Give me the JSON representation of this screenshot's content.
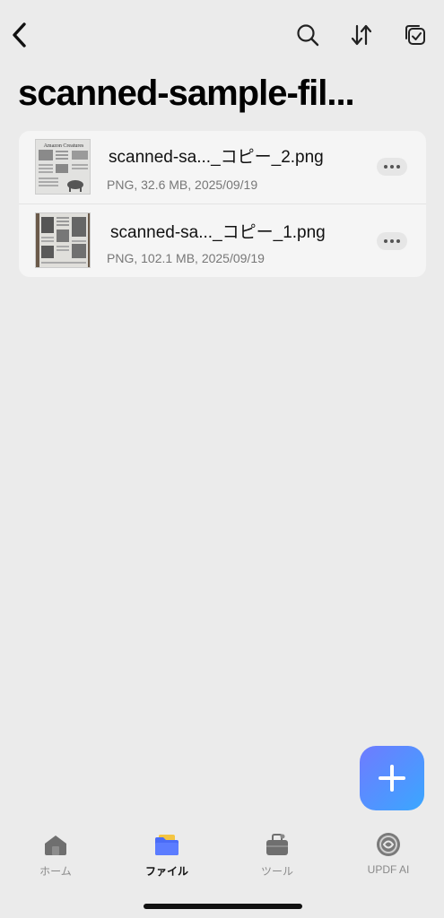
{
  "header": {
    "back_icon": "chevron-left-icon",
    "actions": [
      {
        "icon": "search-icon"
      },
      {
        "icon": "sort-icon"
      },
      {
        "icon": "select-check-icon"
      }
    ],
    "title": "scanned-sample-fil..."
  },
  "files": [
    {
      "name": "scanned-sa..._コピー_2.png",
      "meta": "PNG, 32.6 MB, 2025/09/19",
      "thumbnail_caption": "Amazon Creatures",
      "more_icon": "more-horizontal-icon"
    },
    {
      "name": "scanned-sa..._コピー_1.png",
      "meta": "PNG, 102.1 MB, 2025/09/19",
      "more_icon": "more-horizontal-icon"
    }
  ],
  "fab": {
    "icon": "plus-icon"
  },
  "nav": {
    "items": [
      {
        "label": "ホーム",
        "icon": "home-icon"
      },
      {
        "label": "ファイル",
        "icon": "folder-icon",
        "active": true
      },
      {
        "label": "ツール",
        "icon": "toolbox-icon"
      },
      {
        "label": "UPDF AI",
        "icon": "ai-icon"
      }
    ]
  },
  "colors": {
    "background": "#ebebeb",
    "card": "#f5f5f5",
    "accent_start": "#6f7bff",
    "accent_end": "#3aa7ff",
    "active_tab": "#4a6cf7"
  }
}
